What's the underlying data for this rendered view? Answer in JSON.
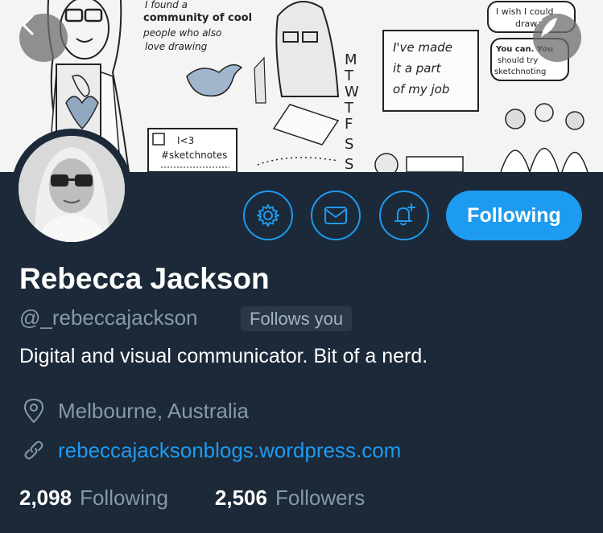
{
  "banner": {
    "texts": {
      "community1": "I found a",
      "community2": "community of cool",
      "community3": "people who also",
      "community4": "love drawing",
      "made1": "I've made",
      "made2": "it a part",
      "made3": "of my job",
      "wish1": "I wish I could",
      "wish2": "draw",
      "youcan1": "You can. You",
      "youcan2": "should try",
      "youcan3": "sketchnoting",
      "heart": "I<3",
      "hashtag": "#sketchnotes",
      "days": [
        "M",
        "T",
        "W",
        "T",
        "F",
        "S",
        "S"
      ]
    }
  },
  "profile": {
    "name": "Rebecca Jackson",
    "handle": "@_rebeccajackson",
    "follows_you": "Follows you",
    "bio": "Digital and visual communicator. Bit of a nerd.",
    "location": "Melbourne, Australia",
    "website": "rebeccajacksonblogs.wordpress.com",
    "following_count": "2,098",
    "following_label": "Following",
    "followers_count": "2,506",
    "followers_label": "Followers"
  },
  "actions": {
    "following_button": "Following"
  },
  "colors": {
    "background": "#1c2938",
    "accent": "#1d9bf0",
    "secondary_text": "#8899a6"
  }
}
